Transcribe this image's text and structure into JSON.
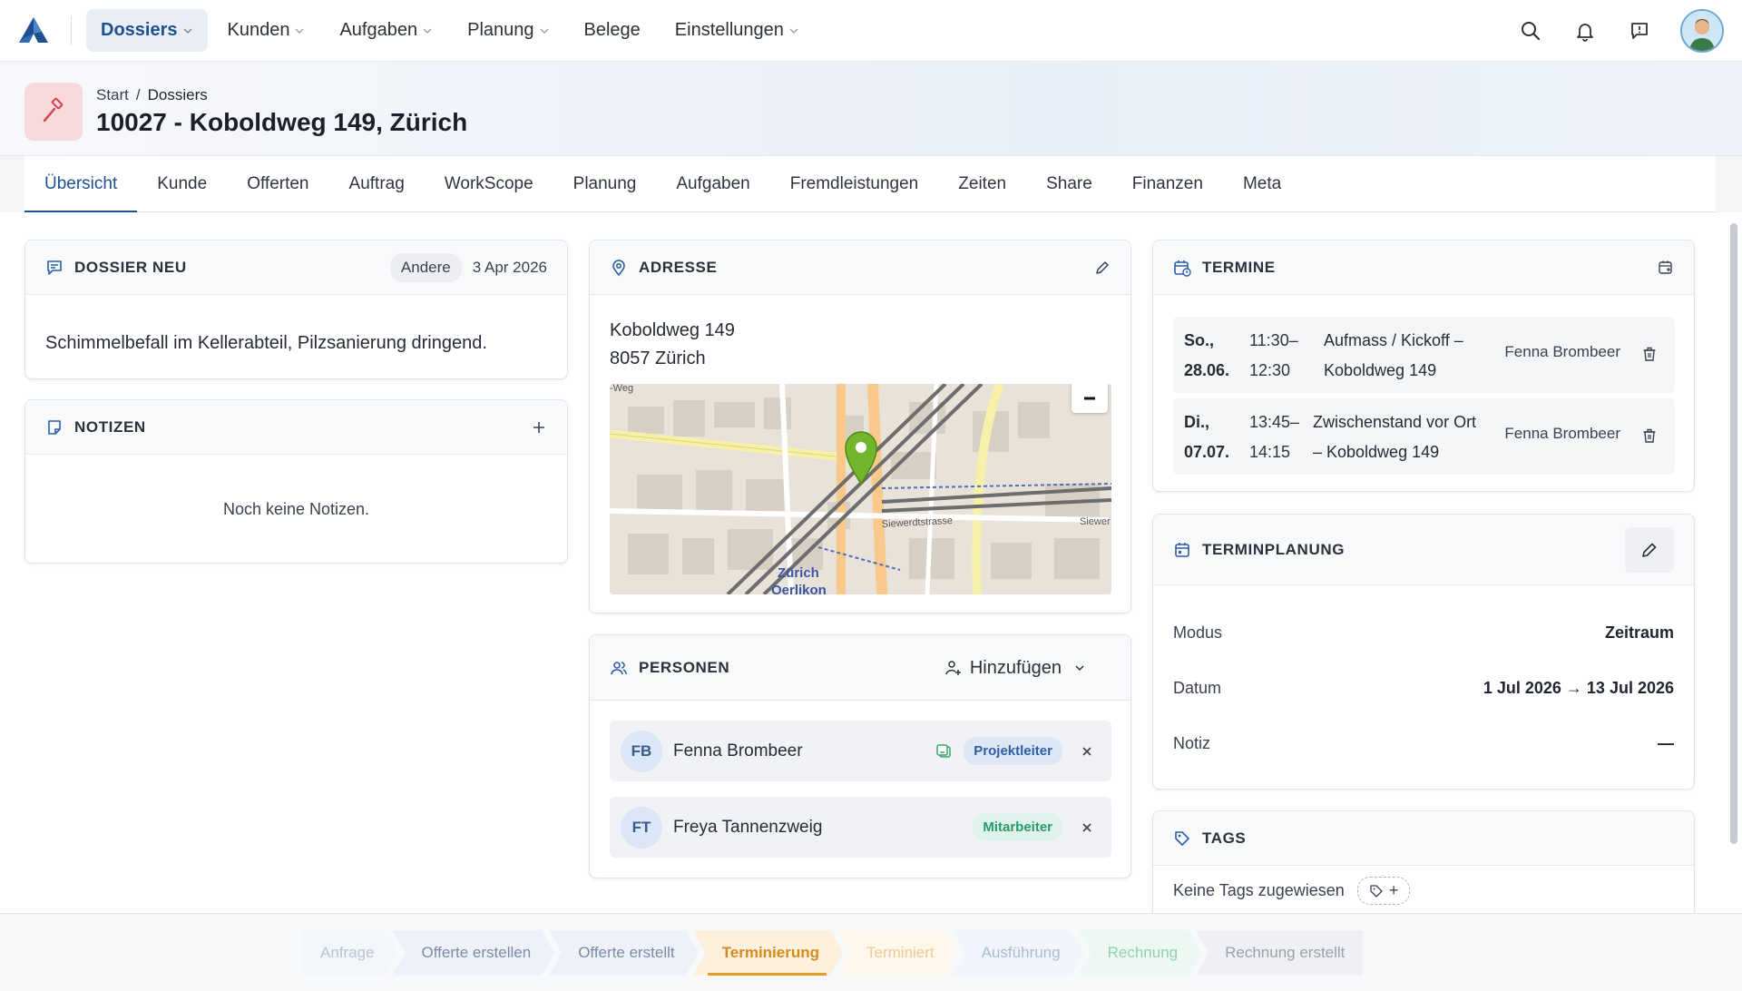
{
  "nav": {
    "items": [
      {
        "label": "Dossiers",
        "active": true,
        "dropdown": true
      },
      {
        "label": "Kunden",
        "active": false,
        "dropdown": true
      },
      {
        "label": "Aufgaben",
        "active": false,
        "dropdown": true
      },
      {
        "label": "Planung",
        "active": false,
        "dropdown": true
      },
      {
        "label": "Belege",
        "active": false,
        "dropdown": false
      },
      {
        "label": "Einstellungen",
        "active": false,
        "dropdown": true
      }
    ],
    "icons": [
      "search-icon",
      "bell-icon",
      "message-icon",
      "avatar"
    ]
  },
  "header": {
    "breadcrumb": [
      "Start",
      "Dossiers"
    ],
    "separator": "/",
    "title": "10027 - Koboldweg 149, Zürich",
    "icon": "hammer-icon"
  },
  "tabs": [
    "Übersicht",
    "Kunde",
    "Offerten",
    "Auftrag",
    "WorkScope",
    "Planung",
    "Aufgaben",
    "Fremdleistungen",
    "Zeiten",
    "Share",
    "Finanzen",
    "Meta"
  ],
  "dossier": {
    "title": "DOSSIER NEU",
    "badge": "Andere",
    "date": "3 Apr 2026",
    "description": "Schimmelbefall im Kellerabteil, Pilzsanierung dringend."
  },
  "notes": {
    "title": "NOTIZEN",
    "empty": "Noch keine Notizen."
  },
  "address": {
    "title": "ADRESSE",
    "line1": "Koboldweg 149",
    "line2": "8057 Zürich",
    "map_labels": {
      "street1": "Siewerdtstrasse",
      "street2": "Siewer",
      "street3": "-Weg",
      "station1": "Zürich",
      "station2": "Oerlikon"
    }
  },
  "persons": {
    "title": "PERSONEN",
    "add_label": "Hinzufügen",
    "items": [
      {
        "initials": "FB",
        "name": "Fenna Brombeer",
        "role": "Projektleiter"
      },
      {
        "initials": "FT",
        "name": "Freya Tannenzweig",
        "role": "Mitarbeiter"
      }
    ]
  },
  "appointments": {
    "title": "TERMINE",
    "items": [
      {
        "day": "So.,",
        "date": "28.06.",
        "start": "11:30–",
        "end": "12:30",
        "title1": "Aufmass / Kickoff –",
        "title2": "Koboldweg 149",
        "who": "Fenna Brombeer"
      },
      {
        "day": "Di.,",
        "date": "07.07.",
        "start": "13:45–",
        "end": "14:15",
        "title1": "Zwischenstand vor Ort",
        "title2": "– Koboldweg 149",
        "who": "Fenna Brombeer"
      }
    ]
  },
  "planning": {
    "title": "TERMINPLANUNG",
    "rows": [
      {
        "key": "Modus",
        "value": "Zeitraum"
      },
      {
        "key": "Datum",
        "value": "1 Jul 2026 → 13 Jul 2026"
      },
      {
        "key": "Notiz",
        "value": "—"
      }
    ]
  },
  "tags": {
    "title": "TAGS",
    "empty": "Keine Tags zugewiesen",
    "add": "+"
  },
  "status_steps": [
    {
      "label": "Anfrage",
      "bg": "#f3f6fb",
      "fg": "#b6c3d6"
    },
    {
      "label": "Offerte erstellen",
      "bg": "#eef2f8",
      "fg": "#7a8ba6"
    },
    {
      "label": "Offerte erstellt",
      "bg": "#eef2f8",
      "fg": "#7a8ba6"
    },
    {
      "label": "Terminierung",
      "bg": "#fdf1dd",
      "fg": "#d98a1c",
      "active": true
    },
    {
      "label": "Terminiert",
      "bg": "#fdf7ee",
      "fg": "#f0c98e"
    },
    {
      "label": "Ausführung",
      "bg": "#f1f5fb",
      "fg": "#a8bbd6"
    },
    {
      "label": "Rechnung",
      "bg": "#eef8f3",
      "fg": "#8fd0b0"
    },
    {
      "label": "Rechnung erstellt",
      "bg": "#eef0f3",
      "fg": "#9aa1ad"
    }
  ],
  "colors": {
    "accent": "#1d4f91",
    "active_step": "#d98a1c"
  }
}
